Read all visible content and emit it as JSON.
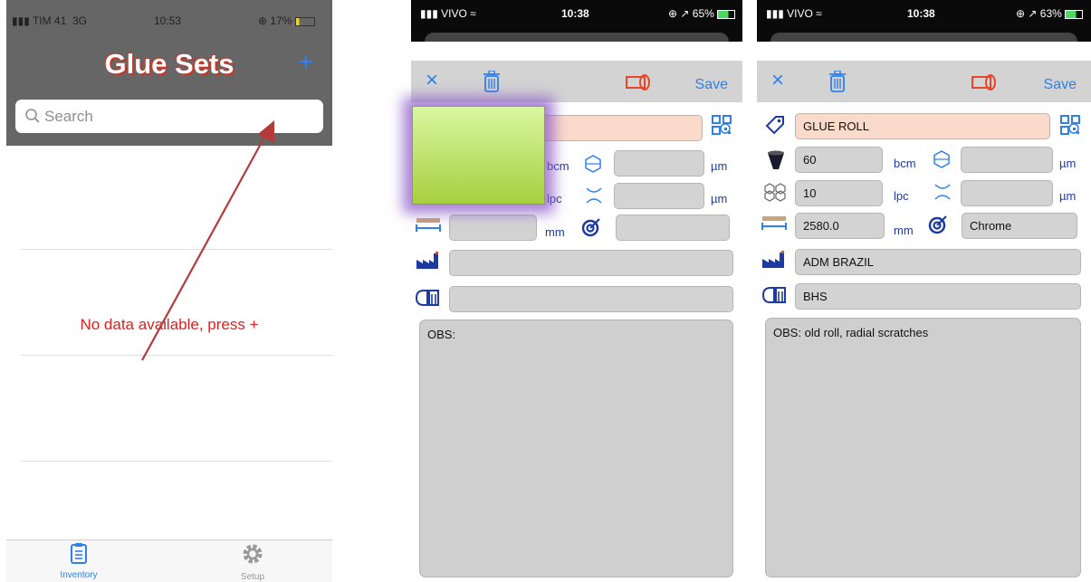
{
  "screen1": {
    "status": {
      "carrier": "TIM 41",
      "network": "3G",
      "time": "10:53",
      "battery": "17%"
    },
    "title": "Glue Sets",
    "add_label": "+",
    "search": {
      "placeholder": "Search"
    },
    "empty_message": "No data available, press +",
    "tabs": [
      {
        "label": "Inventory",
        "icon": "clipboard-icon"
      },
      {
        "label": "Setup",
        "icon": "gear-icon"
      }
    ],
    "colors": {
      "header": "#666666",
      "title_outline": "#c0392b",
      "accent": "#2f80ed",
      "empty_text": "#e02020",
      "arrow": "#b53b3b"
    }
  },
  "screen2": {
    "status": {
      "carrier": "VIVO",
      "time": "10:38",
      "battery": "65%"
    },
    "toolbar": {
      "close": "×",
      "save": "Save"
    },
    "fields": {
      "name": "",
      "volume": "",
      "volume_um": "",
      "lines": "",
      "lines_um": "",
      "length": "",
      "finish": "",
      "manufacturer": "",
      "machine": ""
    },
    "units": {
      "bcm": "bcm",
      "um1": "µm",
      "lpc": "lpc",
      "um2": "µm",
      "mm": "mm"
    },
    "obs": "OBS:"
  },
  "screen3": {
    "status": {
      "carrier": "VIVO",
      "time": "10:38",
      "battery": "63%"
    },
    "toolbar": {
      "close": "×",
      "save": "Save"
    },
    "fields": {
      "name": "GLUE ROLL",
      "volume": "60",
      "volume_um": "",
      "lines": "10",
      "lines_um": "",
      "length": "2580.0",
      "finish": "Chrome",
      "manufacturer": "ADM BRAZIL",
      "machine": "BHS"
    },
    "units": {
      "bcm": "bcm",
      "um1": "µm",
      "lpc": "lpc",
      "um2": "µm",
      "mm": "mm"
    },
    "obs": "OBS: old roll, radial scratches"
  }
}
